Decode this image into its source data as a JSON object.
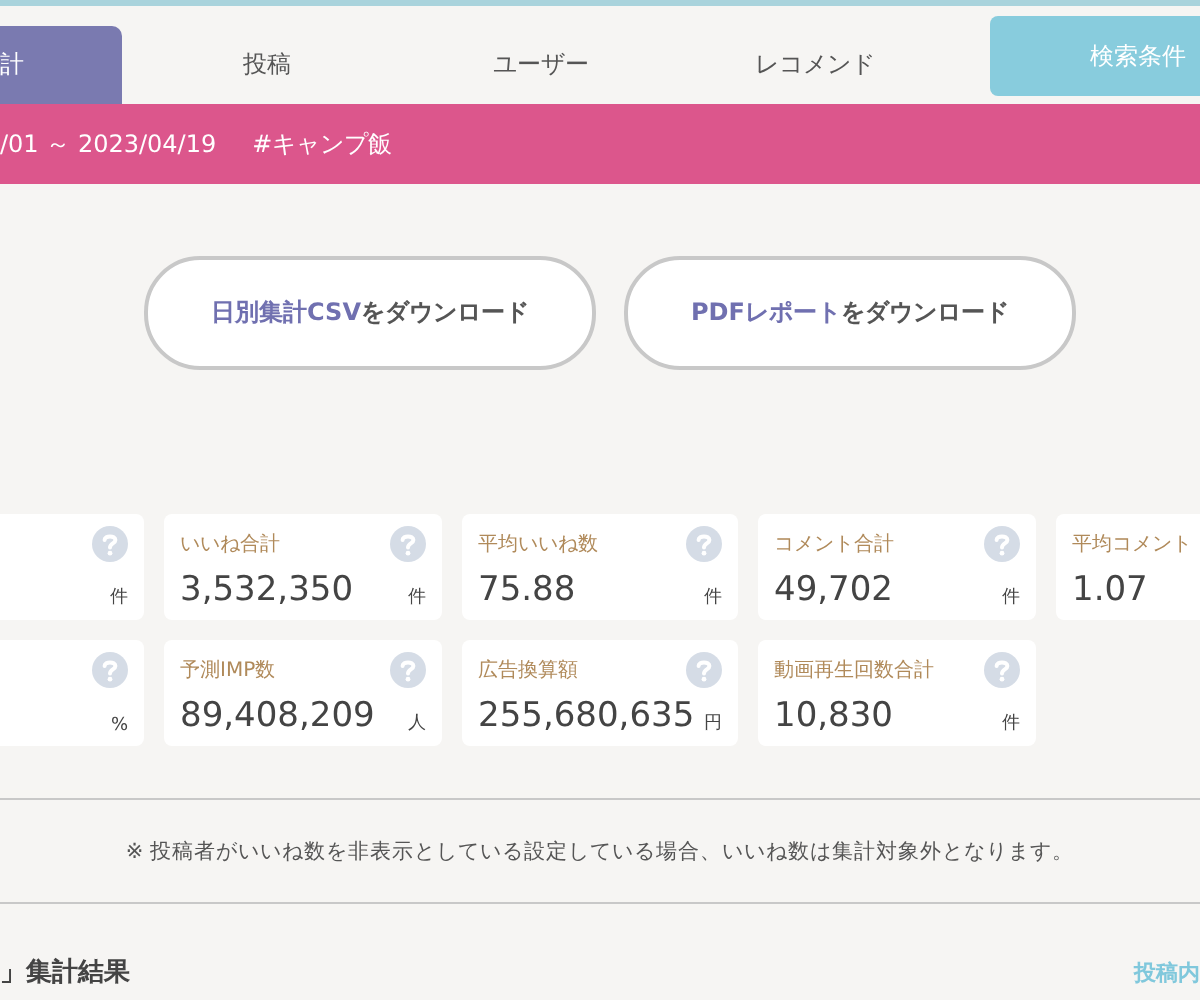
{
  "tabs": [
    {
      "label": "計",
      "selected": true
    },
    {
      "label": "投稿",
      "selected": false
    },
    {
      "label": "ユーザー",
      "selected": false
    },
    {
      "label": "レコメンド",
      "selected": false
    }
  ],
  "search_button": {
    "label": "検索条件"
  },
  "filter_bar": {
    "period": "/01 ～ 2023/04/19",
    "hashtag": "#キャンプ飯"
  },
  "downloads": [
    {
      "highlight": "日別集計CSV",
      "rest": "をダウンロード"
    },
    {
      "highlight": "PDFレポート",
      "rest": "をダウンロード"
    }
  ],
  "metrics": [
    [
      {
        "unit": "件"
      },
      {
        "label": "いいね合計",
        "value": "3,532,350",
        "unit": "件"
      },
      {
        "label": "平均いいね数",
        "value": "75.88",
        "unit": "件"
      },
      {
        "label": "コメント合計",
        "value": "49,702",
        "unit": "件"
      },
      {
        "label": "平均コメント",
        "value": "1.07"
      }
    ],
    [
      {
        "unit": "%"
      },
      {
        "label": "予測IMP数",
        "value": "89,408,209",
        "unit": "人"
      },
      {
        "label": "広告換算額",
        "value": "255,680,635",
        "unit": "円"
      },
      {
        "label": "動画再生回数合計",
        "value": "10,830",
        "unit": "件"
      }
    ]
  ],
  "notice": "※ 投稿者がいいね数を非表示としている設定している場合、いいね数は集計対象外となります。",
  "section": {
    "title": "」集計結果",
    "link": "投稿内"
  }
}
